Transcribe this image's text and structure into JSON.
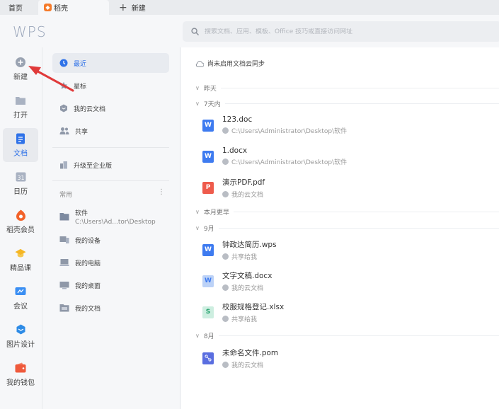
{
  "tabs": {
    "home": "首页",
    "active": "稻壳",
    "new": "新建"
  },
  "header": {
    "brand": "WPS",
    "search_placeholder": "搜索文档、应用、模板、Office 技巧或直接访问网址"
  },
  "rail": [
    {
      "label": "新建",
      "icon": "plus-circle-icon"
    },
    {
      "label": "打开",
      "icon": "folder-icon"
    },
    {
      "label": "文档",
      "icon": "document-icon"
    },
    {
      "label": "日历",
      "icon": "calendar-icon"
    },
    {
      "label": "稻壳会员",
      "icon": "docer-icon"
    },
    {
      "label": "精品课",
      "icon": "graduation-cap-icon"
    },
    {
      "label": "会议",
      "icon": "meeting-icon"
    },
    {
      "label": "图片设计",
      "icon": "image-design-icon"
    },
    {
      "label": "我的钱包",
      "icon": "wallet-icon"
    }
  ],
  "nav": {
    "recent": "最近",
    "starred": "星标",
    "cloud": "我的云文档",
    "shared": "共享",
    "upgrade": "升级至企业版",
    "common_label": "常用",
    "software_name": "软件",
    "software_path": "C:\\Users\\Ad...tor\\Desktop",
    "devices": "我的设备",
    "computer": "我的电脑",
    "desktop": "我的桌面",
    "documents": "我的文档"
  },
  "main": {
    "sync_text": "尚未启用文档云同步",
    "groups": {
      "yesterday": "昨天",
      "week": "7天内",
      "earlier_month": "本月更早",
      "sep": "9月",
      "aug": "8月"
    },
    "files": [
      {
        "name": "123.doc",
        "location": "C:\\Users\\Administrator\\Desktop\\软件",
        "type": "W",
        "color": "#3e7bf0"
      },
      {
        "name": "1.docx",
        "location": "C:\\Users\\Administrator\\Desktop\\软件",
        "type": "W",
        "color": "#3e7bf0"
      },
      {
        "name": "演示PDF.pdf",
        "location": "我的云文档",
        "type": "P",
        "color": "#ee5b4c"
      },
      {
        "name": "钟政达简历.wps",
        "location": "共享给我",
        "type": "W",
        "color": "#3e7bf0"
      },
      {
        "name": "文字文稿.docx",
        "location": "我的云文档",
        "type": "W",
        "color": "#bcd2f7"
      },
      {
        "name": "校服规格登记.xlsx",
        "location": "共享给我",
        "type": "S",
        "color": "#cdeee0"
      },
      {
        "name": "未命名文件.pom",
        "location": "我的云文档",
        "type": "M",
        "color": "#5a6ee0"
      }
    ]
  },
  "colors": {
    "accent": "#2f72e8",
    "annotation_arrow": "#e03a3a"
  }
}
